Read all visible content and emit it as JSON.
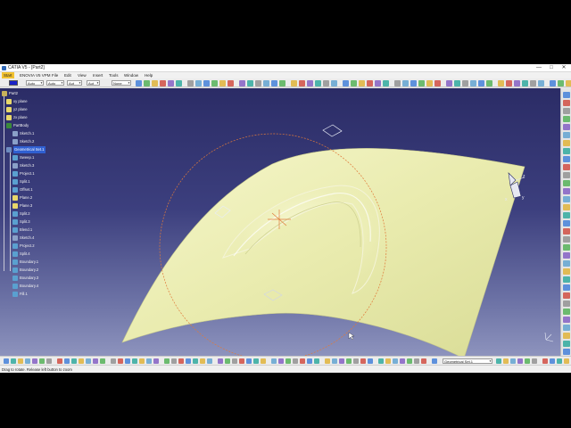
{
  "window": {
    "title": "CATIA V5 - [Part2]",
    "minimize_glyph": "—",
    "maximize_glyph": "□",
    "close_glyph": "✕"
  },
  "menubar": {
    "items": [
      "Start",
      "ENOVIA V5 VPM",
      "File",
      "Edit",
      "View",
      "Insert",
      "Tools",
      "Window",
      "Help"
    ]
  },
  "toolbar_top": {
    "color_swatch": "#1a22c8",
    "combos": [
      "Auto",
      "Auto",
      "Aut",
      "Aut",
      "None"
    ]
  },
  "tree": {
    "items": [
      {
        "label": "Part2",
        "icon": "part-icon",
        "color": "#c8b25a"
      },
      {
        "label": "xy plane",
        "icon": "plane-icon",
        "color": "#e8d76a"
      },
      {
        "label": "yz plane",
        "icon": "plane-icon",
        "color": "#e8d76a"
      },
      {
        "label": "zx plane",
        "icon": "plane-icon",
        "color": "#e8d76a"
      },
      {
        "label": "PartBody",
        "icon": "gear-icon",
        "color": "#3a8a3a"
      },
      {
        "label": "Sketch.1",
        "icon": "sketch-icon",
        "color": "#8aa0c8"
      },
      {
        "label": "Sketch.2",
        "icon": "sketch-icon",
        "color": "#8aa0c8"
      },
      {
        "label": "Geometrical Set.1",
        "icon": "geometrical-set-icon",
        "color": "#6e8cc0"
      },
      {
        "label": "Sweep.1",
        "icon": "sweep-icon",
        "color": "#5aa0d0"
      },
      {
        "label": "Sketch.3",
        "icon": "sketch-icon",
        "color": "#8aa0c8"
      },
      {
        "label": "Project.1",
        "icon": "project-icon",
        "color": "#5aa0d0"
      },
      {
        "label": "Split.1",
        "icon": "split-icon",
        "color": "#5aa0d0"
      },
      {
        "label": "Offset.1",
        "icon": "offset-icon",
        "color": "#5aa0d0"
      },
      {
        "label": "Plane.2",
        "icon": "plane-icon",
        "color": "#e8d76a"
      },
      {
        "label": "Plane.3",
        "icon": "plane-icon",
        "color": "#e8d76a"
      },
      {
        "label": "Split.2",
        "icon": "split-icon",
        "color": "#5aa0d0"
      },
      {
        "label": "Split.3",
        "icon": "split-icon",
        "color": "#5aa0d0"
      },
      {
        "label": "Blend.1",
        "icon": "blend-icon",
        "color": "#5aa0d0"
      },
      {
        "label": "Sketch.4",
        "icon": "sketch-icon",
        "color": "#8aa0c8"
      },
      {
        "label": "Project.2",
        "icon": "project-icon",
        "color": "#5aa0d0"
      },
      {
        "label": "Split.4",
        "icon": "split-icon",
        "color": "#5aa0d0"
      },
      {
        "label": "Boundary.1",
        "icon": "boundary-icon",
        "color": "#5aa0d0"
      },
      {
        "label": "Boundary.2",
        "icon": "boundary-icon",
        "color": "#5aa0d0"
      },
      {
        "label": "Boundary.3",
        "icon": "boundary-icon",
        "color": "#5aa0d0"
      },
      {
        "label": "Boundary.4",
        "icon": "boundary-icon",
        "color": "#5aa0d0"
      },
      {
        "label": "Fill.1",
        "icon": "fill-icon",
        "color": "#5aa0d0"
      }
    ],
    "selected_label": "Geometrical Set.1"
  },
  "viewport": {
    "surface_color": "#eef0b4",
    "circle_color": "#e07a3a",
    "compass_icon": "compass-icon"
  },
  "toolbar_bottom": {
    "combo_value": "Geometrical Set.1"
  },
  "status": {
    "text": "Drag to rotate. Release left button to zoom"
  }
}
